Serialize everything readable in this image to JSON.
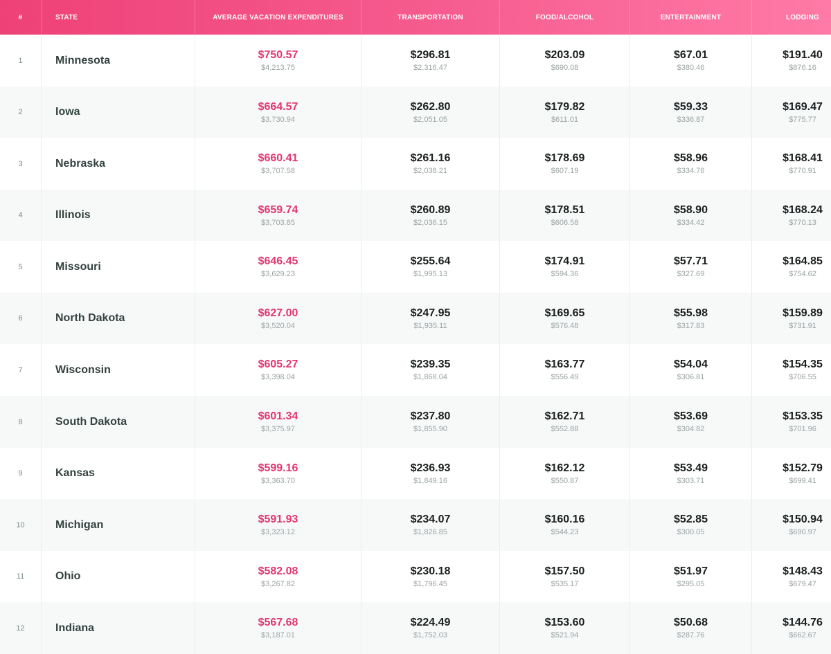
{
  "colors": {
    "header_start": "#ee4178",
    "header_end": "#ff7aa6",
    "accent_value": "#e2376f",
    "row_alt": "#f7f9f9"
  },
  "headers": {
    "rank": "#",
    "state": "STATE",
    "average": "AVERAGE VACATION EXPENDITURES",
    "transportation": "TRANSPORTATION",
    "food": "FOOD/ALCOHOL",
    "entertainment": "ENTERTAINMENT",
    "lodging": "LODGING"
  },
  "rows": [
    {
      "rank": "1",
      "state": "Minnesota",
      "avg": "$750.57",
      "avg_total": "$4,213.75",
      "trans": "$296.81",
      "trans_total": "$2,316.47",
      "food": "$203.09",
      "food_total": "$690.08",
      "ent": "$67.01",
      "ent_total": "$380.46",
      "lodg": "$191.40",
      "lodg_total": "$876.16"
    },
    {
      "rank": "2",
      "state": "Iowa",
      "avg": "$664.57",
      "avg_total": "$3,730.94",
      "trans": "$262.80",
      "trans_total": "$2,051.05",
      "food": "$179.82",
      "food_total": "$611.01",
      "ent": "$59.33",
      "ent_total": "$336.87",
      "lodg": "$169.47",
      "lodg_total": "$775.77"
    },
    {
      "rank": "3",
      "state": "Nebraska",
      "avg": "$660.41",
      "avg_total": "$3,707.58",
      "trans": "$261.16",
      "trans_total": "$2,038.21",
      "food": "$178.69",
      "food_total": "$607.19",
      "ent": "$58.96",
      "ent_total": "$334.76",
      "lodg": "$168.41",
      "lodg_total": "$770.91"
    },
    {
      "rank": "4",
      "state": "Illinois",
      "avg": "$659.74",
      "avg_total": "$3,703.85",
      "trans": "$260.89",
      "trans_total": "$2,036.15",
      "food": "$178.51",
      "food_total": "$606.58",
      "ent": "$58.90",
      "ent_total": "$334.42",
      "lodg": "$168.24",
      "lodg_total": "$770.13"
    },
    {
      "rank": "5",
      "state": "Missouri",
      "avg": "$646.45",
      "avg_total": "$3,629.23",
      "trans": "$255.64",
      "trans_total": "$1,995.13",
      "food": "$174.91",
      "food_total": "$594.36",
      "ent": "$57.71",
      "ent_total": "$327.69",
      "lodg": "$164.85",
      "lodg_total": "$754.62"
    },
    {
      "rank": "6",
      "state": "North Dakota",
      "avg": "$627.00",
      "avg_total": "$3,520.04",
      "trans": "$247.95",
      "trans_total": "$1,935.11",
      "food": "$169.65",
      "food_total": "$576.48",
      "ent": "$55.98",
      "ent_total": "$317.83",
      "lodg": "$159.89",
      "lodg_total": "$731.91"
    },
    {
      "rank": "7",
      "state": "Wisconsin",
      "avg": "$605.27",
      "avg_total": "$3,398.04",
      "trans": "$239.35",
      "trans_total": "$1,868.04",
      "food": "$163.77",
      "food_total": "$556.49",
      "ent": "$54.04",
      "ent_total": "$306.81",
      "lodg": "$154.35",
      "lodg_total": "$706.55"
    },
    {
      "rank": "8",
      "state": "South Dakota",
      "avg": "$601.34",
      "avg_total": "$3,375.97",
      "trans": "$237.80",
      "trans_total": "$1,855.90",
      "food": "$162.71",
      "food_total": "$552.88",
      "ent": "$53.69",
      "ent_total": "$304.82",
      "lodg": "$153.35",
      "lodg_total": "$701.96"
    },
    {
      "rank": "9",
      "state": "Kansas",
      "avg": "$599.16",
      "avg_total": "$3,363.70",
      "trans": "$236.93",
      "trans_total": "$1,849.16",
      "food": "$162.12",
      "food_total": "$550.87",
      "ent": "$53.49",
      "ent_total": "$303.71",
      "lodg": "$152.79",
      "lodg_total": "$699.41"
    },
    {
      "rank": "10",
      "state": "Michigan",
      "avg": "$591.93",
      "avg_total": "$3,323.12",
      "trans": "$234.07",
      "trans_total": "$1,826.85",
      "food": "$160.16",
      "food_total": "$544.23",
      "ent": "$52.85",
      "ent_total": "$300.05",
      "lodg": "$150.94",
      "lodg_total": "$690.97"
    },
    {
      "rank": "11",
      "state": "Ohio",
      "avg": "$582.08",
      "avg_total": "$3,267.82",
      "trans": "$230.18",
      "trans_total": "$1,796.45",
      "food": "$157.50",
      "food_total": "$535.17",
      "ent": "$51.97",
      "ent_total": "$295.05",
      "lodg": "$148.43",
      "lodg_total": "$679.47"
    },
    {
      "rank": "12",
      "state": "Indiana",
      "avg": "$567.68",
      "avg_total": "$3,187.01",
      "trans": "$224.49",
      "trans_total": "$1,752.03",
      "food": "$153.60",
      "food_total": "$521.94",
      "ent": "$50.68",
      "ent_total": "$287.76",
      "lodg": "$144.76",
      "lodg_total": "$662.67"
    }
  ]
}
